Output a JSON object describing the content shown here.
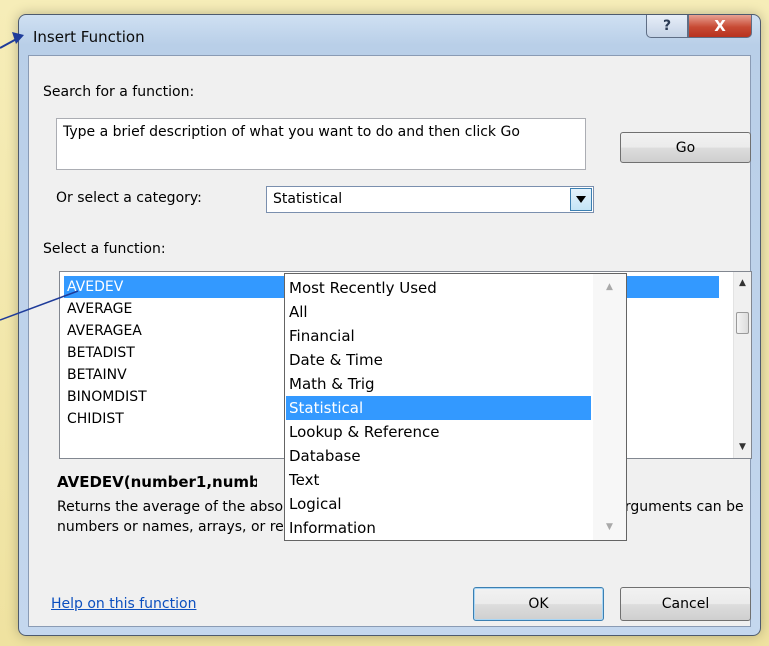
{
  "window": {
    "title": "Insert Function",
    "help_label": "?",
    "close_label": "X"
  },
  "search": {
    "label": "Search for a function:",
    "value": "Type a brief description of what you want to do and then click Go",
    "go_label": "Go"
  },
  "category": {
    "label": "Or select a category:",
    "selected": "Statistical",
    "options": [
      "Most Recently Used",
      "All",
      "Financial",
      "Date & Time",
      "Math & Trig",
      "Statistical",
      "Lookup & Reference",
      "Database",
      "Text",
      "Logical",
      "Information"
    ]
  },
  "functions": {
    "label": "Select a function:",
    "items": [
      "AVEDEV",
      "AVERAGE",
      "AVERAGEA",
      "BETADIST",
      "BETAINV",
      "BINOMDIST",
      "CHIDIST"
    ],
    "selected": "AVEDEV"
  },
  "details": {
    "signature": "AVEDEV(number1,number2,...)",
    "description": "Returns the average of the absolute deviations of data points from their mean. Arguments can be numbers or names, arrays, or references that contain numbers."
  },
  "footer": {
    "help_link": "Help on this function",
    "ok_label": "OK",
    "cancel_label": "Cancel"
  },
  "colors": {
    "selection": "#3399ff",
    "background": "#f3e7a4",
    "callout": "#1f3c9a",
    "link": "#0b4fbf"
  }
}
